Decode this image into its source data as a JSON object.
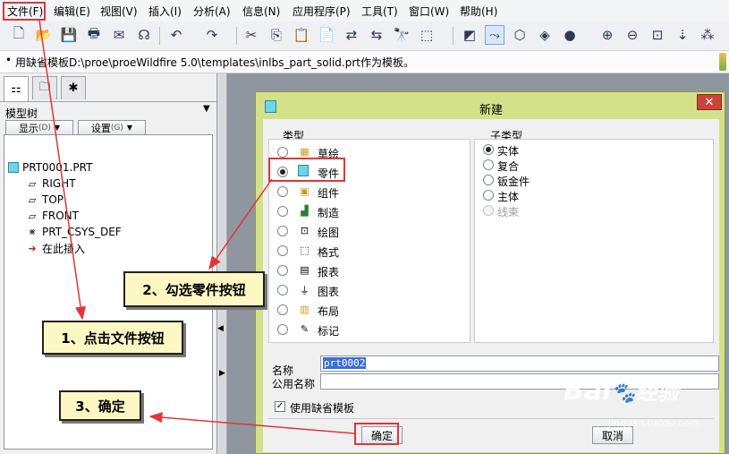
{
  "menu": {
    "items": [
      "文件(F)",
      "编辑(E)",
      "视图(V)",
      "插入(I)",
      "分析(A)",
      "信息(N)",
      "应用程序(P)",
      "工具(T)",
      "窗口(W)",
      "帮助(H)"
    ]
  },
  "toolbar": {
    "icons": [
      "new-icon",
      "open-icon",
      "save-icon",
      "print-icon",
      "email-icon",
      "send-icon",
      "undo-icon",
      "redo-icon",
      "cut-icon",
      "copy-icon",
      "paste-icon",
      "paste-special-icon",
      "regenerate-icon",
      "regenerate-manager-icon",
      "find-icon",
      "select-box-icon",
      "datum-display-icon",
      "spin-center-icon",
      "view-orient-icon",
      "shading-icon",
      "zoom-in-icon",
      "zoom-out-icon",
      "refit-icon",
      "repaint-icon",
      "annotation-icon"
    ]
  },
  "message": {
    "text": "用缺省模板D:\\proe\\proeWildfire 5.0\\templates\\inlbs_part_solid.prt作为模板。"
  },
  "left_panel": {
    "title": "模型树",
    "show_button": "显示",
    "show_shortcut": "(D)",
    "settings_button": "设置",
    "settings_shortcut": "(G)",
    "tree": [
      {
        "label": "PRT0001.PRT",
        "icon": "part-icon"
      },
      {
        "label": "RIGHT",
        "icon": "datum-plane-icon"
      },
      {
        "label": "TOP",
        "icon": "datum-plane-icon"
      },
      {
        "label": "FRONT",
        "icon": "datum-plane-icon"
      },
      {
        "label": "PRT_CSYS_DEF",
        "icon": "csys-icon"
      },
      {
        "label": "在此插入",
        "icon": "insert-here-icon"
      }
    ]
  },
  "dialog": {
    "title": "新建",
    "type_group": "类型",
    "types": [
      {
        "label": "草绘",
        "selected": false
      },
      {
        "label": "零件",
        "selected": true
      },
      {
        "label": "组件",
        "selected": false
      },
      {
        "label": "制造",
        "selected": false
      },
      {
        "label": "绘图",
        "selected": false
      },
      {
        "label": "格式",
        "selected": false
      },
      {
        "label": "报表",
        "selected": false
      },
      {
        "label": "图表",
        "selected": false
      },
      {
        "label": "布局",
        "selected": false
      },
      {
        "label": "标记",
        "selected": false
      }
    ],
    "subtype_group": "子类型",
    "subtypes": [
      {
        "label": "实体",
        "selected": true,
        "enabled": true
      },
      {
        "label": "复合",
        "selected": false,
        "enabled": true
      },
      {
        "label": "钣金件",
        "selected": false,
        "enabled": true
      },
      {
        "label": "主体",
        "selected": false,
        "enabled": true
      },
      {
        "label": "线束",
        "selected": false,
        "enabled": false
      }
    ],
    "name_label": "名称",
    "name_value": "prt0002",
    "common_name_label": "公用名称",
    "common_name_value": "",
    "use_default_template": "使用缺省模板",
    "use_default_checked": true,
    "ok": "确定",
    "cancel": "取消"
  },
  "annotations": {
    "step1": "1、点击文件按钮",
    "step2": "2、勾选零件按钮",
    "step3": "3、确定"
  },
  "watermark": {
    "brand": "Bai",
    "brand2": "经验",
    "url": "jingyan.baidu.com"
  },
  "colors": {
    "dialog_frame": "#d3e189",
    "callout_bg": "#fdf7c4",
    "highlight": "#e0353a",
    "close_button": "#c9443b"
  }
}
